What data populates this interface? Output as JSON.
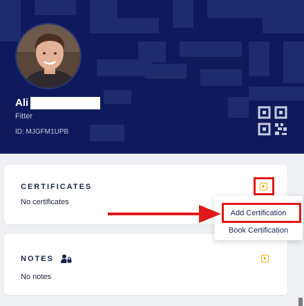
{
  "profile": {
    "name": "Ali",
    "role": "Fitter",
    "member_id": "ID: MJGFM1UPB"
  },
  "certificates": {
    "title": "CERTIFICATES",
    "empty_text": "No certificates",
    "add_icon": "plus-square-icon"
  },
  "menu": {
    "items": [
      {
        "label": "Add Certification"
      },
      {
        "label": "Book Certification"
      }
    ]
  },
  "notes": {
    "title": "NOTES",
    "title_icon": "user-lock-icon",
    "empty_text": "No notes",
    "add_icon": "plus-square-icon"
  },
  "colors": {
    "banner": "#0e1a5c",
    "accent": "#f0ad0c",
    "annotation": "#e01818"
  }
}
